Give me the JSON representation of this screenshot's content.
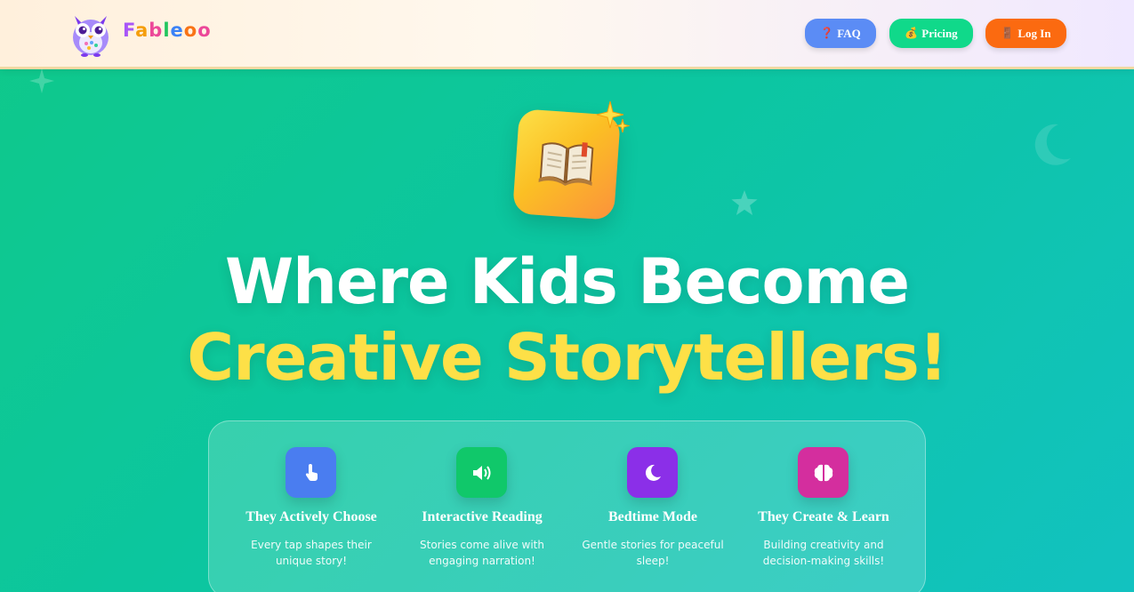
{
  "header": {
    "brand_letters": [
      "F",
      "a",
      "b",
      "l",
      "e",
      "o",
      "o"
    ],
    "nav": {
      "faq": {
        "icon": "question-mark-icon",
        "glyph": "❓",
        "label": "FAQ"
      },
      "pricing": {
        "icon": "money-bag-icon",
        "glyph": "💰",
        "label": "Pricing"
      },
      "login": {
        "icon": "door-icon",
        "glyph": "🚪",
        "label": "Log In"
      }
    }
  },
  "hero": {
    "icon": "open-book-icon",
    "title_line1": "Where Kids Become",
    "title_line2": "Creative Storytellers!"
  },
  "features": [
    {
      "icon": "tap-hand-icon",
      "title": "They Actively Choose",
      "desc": "Every tap shapes their unique story!",
      "color": "#4a7df0"
    },
    {
      "icon": "speaker-icon",
      "title": "Interactive Reading",
      "desc": "Stories come alive with engaging narration!",
      "color": "#10c86a"
    },
    {
      "icon": "moon-icon",
      "title": "Bedtime Mode",
      "desc": "Gentle stories for peaceful sleep!",
      "color": "#8b2fe8"
    },
    {
      "icon": "brain-icon",
      "title": "They Create & Learn",
      "desc": "Building creativity and decision-making skills!",
      "color": "#d42e9e"
    }
  ]
}
